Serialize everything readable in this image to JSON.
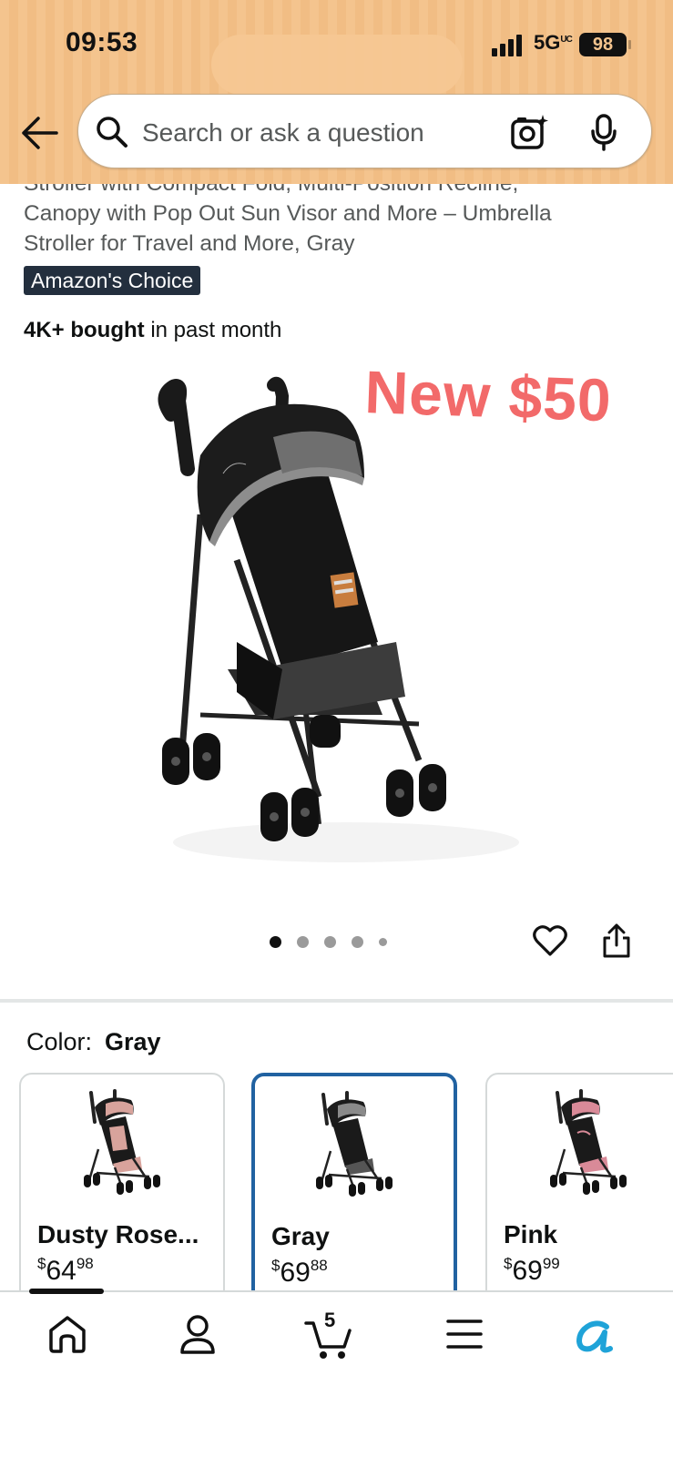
{
  "status_bar": {
    "time": "09:53",
    "network": "5G",
    "network_sup": "UC",
    "battery": "98"
  },
  "search": {
    "placeholder": "Search or ask a question"
  },
  "product": {
    "title_lines": [
      "Stroller with Compact Fold, Multi-Position Recline,",
      "Canopy with Pop Out Sun Visor and More – Umbrella",
      "Stroller for Travel and More, Gray"
    ],
    "badge": "Amazon's Choice",
    "bought_bold": "4K+ bought",
    "bought_rest": " in past month",
    "promo_overlay": "New $50",
    "image_dots": 5,
    "active_dot": 0
  },
  "color": {
    "label": "Color:",
    "selected": "Gray",
    "options": [
      {
        "name": "Dusty Rose...",
        "currency": "$",
        "whole": "64",
        "fraction": "98",
        "canopy_color": "#d8a39c"
      },
      {
        "name": "Gray",
        "currency": "$",
        "whole": "69",
        "fraction": "88",
        "canopy_color": "#8a8a8a"
      },
      {
        "name": "Pink",
        "currency": "$",
        "whole": "69",
        "fraction": "99",
        "canopy_color": "#d98a98"
      }
    ]
  },
  "nav": {
    "cart_count": "5",
    "items": [
      "home-icon",
      "account-icon",
      "cart-icon",
      "menu-icon",
      "rufus-icon"
    ]
  },
  "colors": {
    "header_bg": "#f4c48e",
    "promo_text": "#f26a6a",
    "badge_bg": "#232f3e",
    "selected_border": "#2162a1",
    "rufus_accent": "#1fa3d8"
  }
}
